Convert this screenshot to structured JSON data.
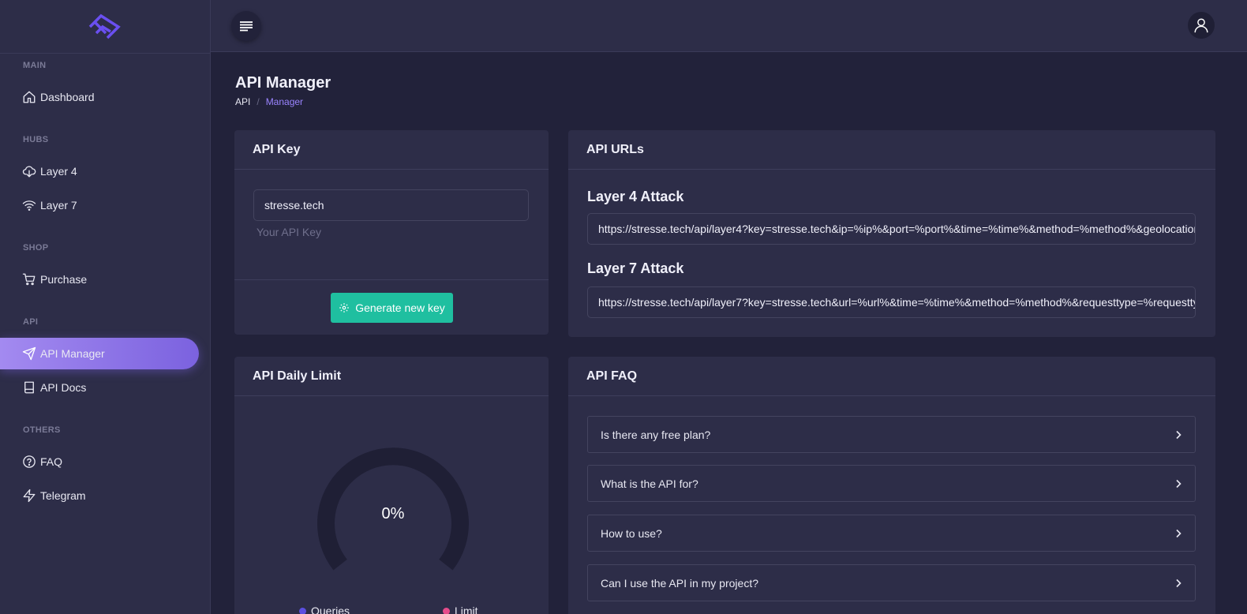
{
  "sidebar": {
    "sections": {
      "main": "MAIN",
      "hubs": "HUBS",
      "shop": "SHOP",
      "api": "API",
      "others": "OTHERS"
    },
    "items": {
      "dashboard": "Dashboard",
      "layer4": "Layer 4",
      "layer7": "Layer 7",
      "purchase": "Purchase",
      "api_manager": "API Manager",
      "api_docs": "API Docs",
      "faq": "FAQ",
      "telegram": "Telegram"
    },
    "active": "api_manager"
  },
  "page": {
    "title": "API Manager",
    "breadcrumb": {
      "root": "API",
      "separator": "/",
      "current": "Manager"
    }
  },
  "api_key_card": {
    "title": "API Key",
    "value": "stresse.tech",
    "help": "Your API Key",
    "button": "Generate new key"
  },
  "api_urls_card": {
    "title": "API URLs",
    "layer4_label": "Layer 4 Attack",
    "layer4_url": "https://stresse.tech/api/layer4?key=stresse.tech&ip=%ip%&port=%port%&time=%time%&method=%method%&geolocation",
    "layer7_label": "Layer 7 Attack",
    "layer7_url": "https://stresse.tech/api/layer7?key=stresse.tech&url=%url%&time=%time%&method=%method%&requesttype=%requesttype"
  },
  "daily_limit_card": {
    "title": "API Daily Limit",
    "percent_label": "0%",
    "percent_value": 0,
    "legend": {
      "queries": "Queries",
      "limit": "Limit"
    }
  },
  "faq_card": {
    "title": "API FAQ",
    "questions": [
      "Is there any free plan?",
      "What is the API for?",
      "How to use?",
      "Can I use the API in my project?"
    ]
  },
  "colors": {
    "accent": "#7b62df",
    "button": "#1fbfa0",
    "queries_dot": "#5b4fe0",
    "limit_dot": "#e74c8b"
  }
}
